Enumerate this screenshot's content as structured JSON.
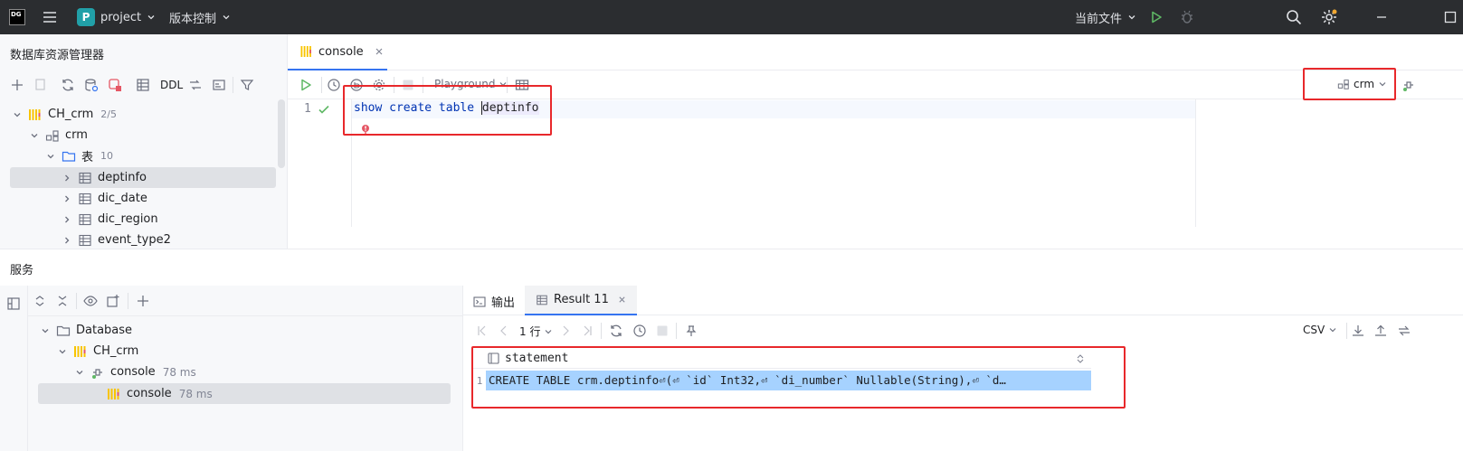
{
  "titlebar": {
    "app_logo": "DG",
    "project_badge": "P",
    "project_name": "project",
    "vcs_label": "版本控制",
    "current_file_label": "当前文件"
  },
  "explorer": {
    "title": "数据库资源管理器",
    "toolbar_ddl": "DDL",
    "tree": {
      "datasource": {
        "name": "CH_crm",
        "count": "2/5"
      },
      "schema": {
        "name": "crm"
      },
      "tables_folder": {
        "name": "表",
        "count": "10"
      },
      "tables": [
        "deptinfo",
        "dic_date",
        "dic_region",
        "event_type2"
      ]
    }
  },
  "editor": {
    "tab_label": "console",
    "playground_label": "Playground",
    "schema_selector": "crm",
    "line_number": "1",
    "sql_keywords": "show create table ",
    "sql_identifier": "deptinfo"
  },
  "services": {
    "title": "服务",
    "tree": {
      "root": "Database",
      "datasource": "CH_crm",
      "session": {
        "name": "console",
        "time": "78 ms"
      },
      "console": {
        "name": "console",
        "time": "78 ms"
      }
    },
    "tabs": {
      "output": "输出",
      "result": "Result 11"
    },
    "result_toolbar": {
      "rows_label": "1 行",
      "export_format": "CSV"
    },
    "result_table": {
      "column": "statement",
      "row_number": "1",
      "cell": "CREATE TABLE crm.deptinfo⏎(⏎    `id` Int32,⏎    `di_number` Nullable(String),⏎    `d…"
    }
  },
  "colors": {
    "accent": "#3574f0",
    "highlight_box": "#e8282b",
    "run_green": "#5fb865",
    "selection_blue": "#a6d2ff",
    "ch_logo_yellow": "#f8c400",
    "error_red": "#e55765"
  }
}
